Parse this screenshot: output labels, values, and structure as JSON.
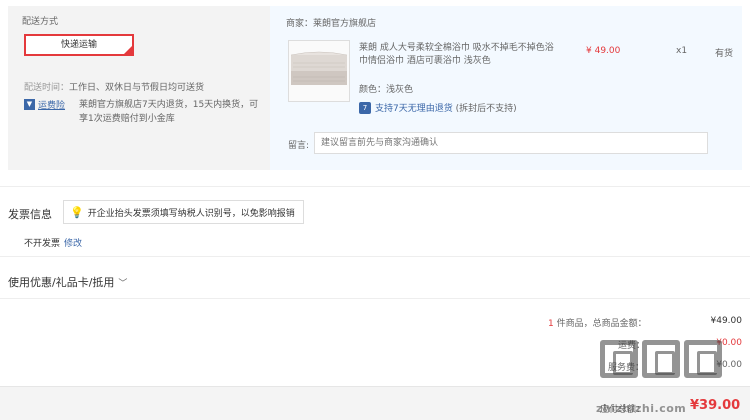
{
  "shipping": {
    "section_label": "配送方式",
    "method_button": "快递运输",
    "time_label": "配送时间：",
    "time_value": "工作日、双休日与节假日均可送货",
    "insurance_badge": "运费险",
    "insurance_desc": "莱朗官方旗舰店7天内退货，15天内换货，可享1次运费赔付到小金库"
  },
  "store": {
    "name_prefix": "商家：",
    "name": "莱朗官方旗舰店",
    "product": {
      "title": "莱朗 成人大号柔软全棉浴巾 吸水不掉毛不掉色浴巾情侣浴巾 酒店可裹浴巾 浅灰色",
      "price": "¥ 49.00",
      "quantity": "x1",
      "stock": "有货",
      "color_label": "颜色：",
      "color_value": "浅灰色",
      "return_policy": "支持7天无理由退货",
      "return_note": "(拆封后不支持)"
    },
    "message_label": "留言:",
    "message_placeholder": "建议留言前先与商家沟通确认"
  },
  "invoice": {
    "title": "发票信息",
    "tip": "开企业抬头发票须填写纳税人识别号，以免影响报销",
    "status": "不开发票",
    "edit": "修改"
  },
  "coupon": {
    "label": "使用优惠/礼品卡/抵用"
  },
  "summary": {
    "item_count": "1",
    "item_count_suffix": " 件商品，总商品金额：",
    "total_goods": "¥49.00",
    "row2_label": "运费：",
    "row2_value": "¥0.00",
    "row3_label": "服务费：",
    "row3_value": "¥0.00",
    "payable_label": "应付总额：",
    "payable_value": "¥39.00"
  },
  "watermark": {
    "text": "zhizhizhi.com"
  },
  "colors": {
    "accent_red": "#e4393c",
    "link_blue": "#3b67a8"
  }
}
